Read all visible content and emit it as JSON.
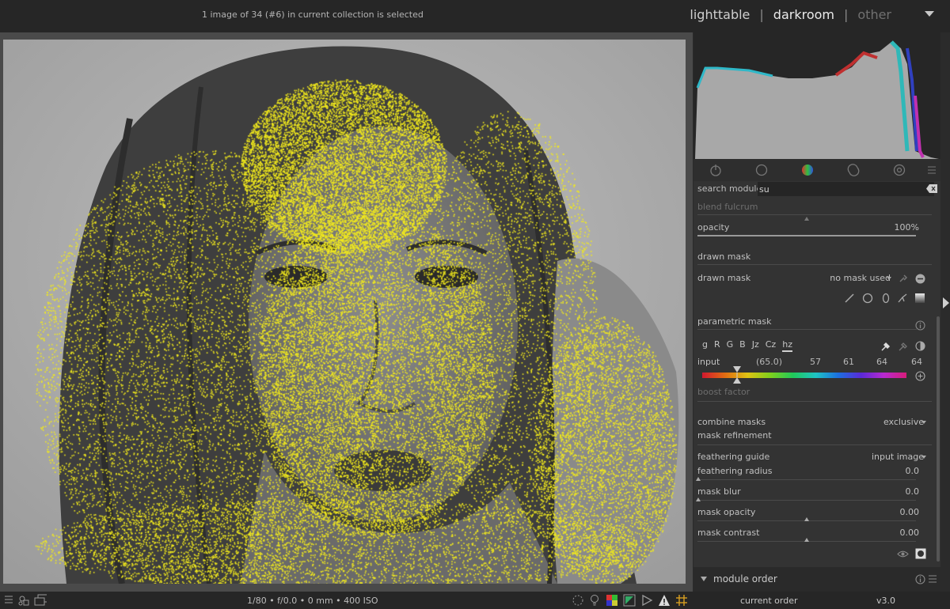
{
  "topbar": {
    "status": "1 image of 34 (#6) in current collection is selected",
    "views": {
      "lighttable": "lighttable",
      "darkroom": "darkroom",
      "other": "other",
      "separator": "|"
    }
  },
  "search": {
    "label": "search module",
    "value": "su"
  },
  "blend": {
    "blend_fulcrum": "blend fulcrum",
    "opacity_label": "opacity",
    "opacity_value": "100%",
    "drawn_mask_header": "drawn mask",
    "drawn_mask_label": "drawn mask",
    "drawn_mask_value": "no mask used",
    "parametric_mask_header": "parametric mask",
    "channels": [
      "g",
      "R",
      "G",
      "B",
      "Jz",
      "Cz",
      "hz"
    ],
    "input_label": "input",
    "input_current": "(65.0)",
    "input_values": [
      "57",
      "61",
      "64",
      "64"
    ],
    "boost_factor": "boost factor",
    "combine_masks_label": "combine masks",
    "combine_masks_value": "exclusive",
    "mask_refinement": "mask refinement",
    "feathering_guide_label": "feathering guide",
    "feathering_guide_value": "input image",
    "feathering_radius_label": "feathering radius",
    "feathering_radius_value": "0.0",
    "mask_blur_label": "mask blur",
    "mask_blur_value": "0.0",
    "mask_opacity_label": "mask opacity",
    "mask_opacity_value": "0.00",
    "mask_contrast_label": "mask contrast",
    "mask_contrast_value": "0.00"
  },
  "module_order": {
    "title": "module order",
    "current_label": "current order",
    "current_value": "v3.0"
  },
  "bottombar": {
    "exif": "1/80 • f/0.0 • 0 mm • 400 ISO"
  },
  "colors": {
    "mask": "#f2ea1c",
    "panel": "#333333",
    "background": "#2b2b2b"
  }
}
